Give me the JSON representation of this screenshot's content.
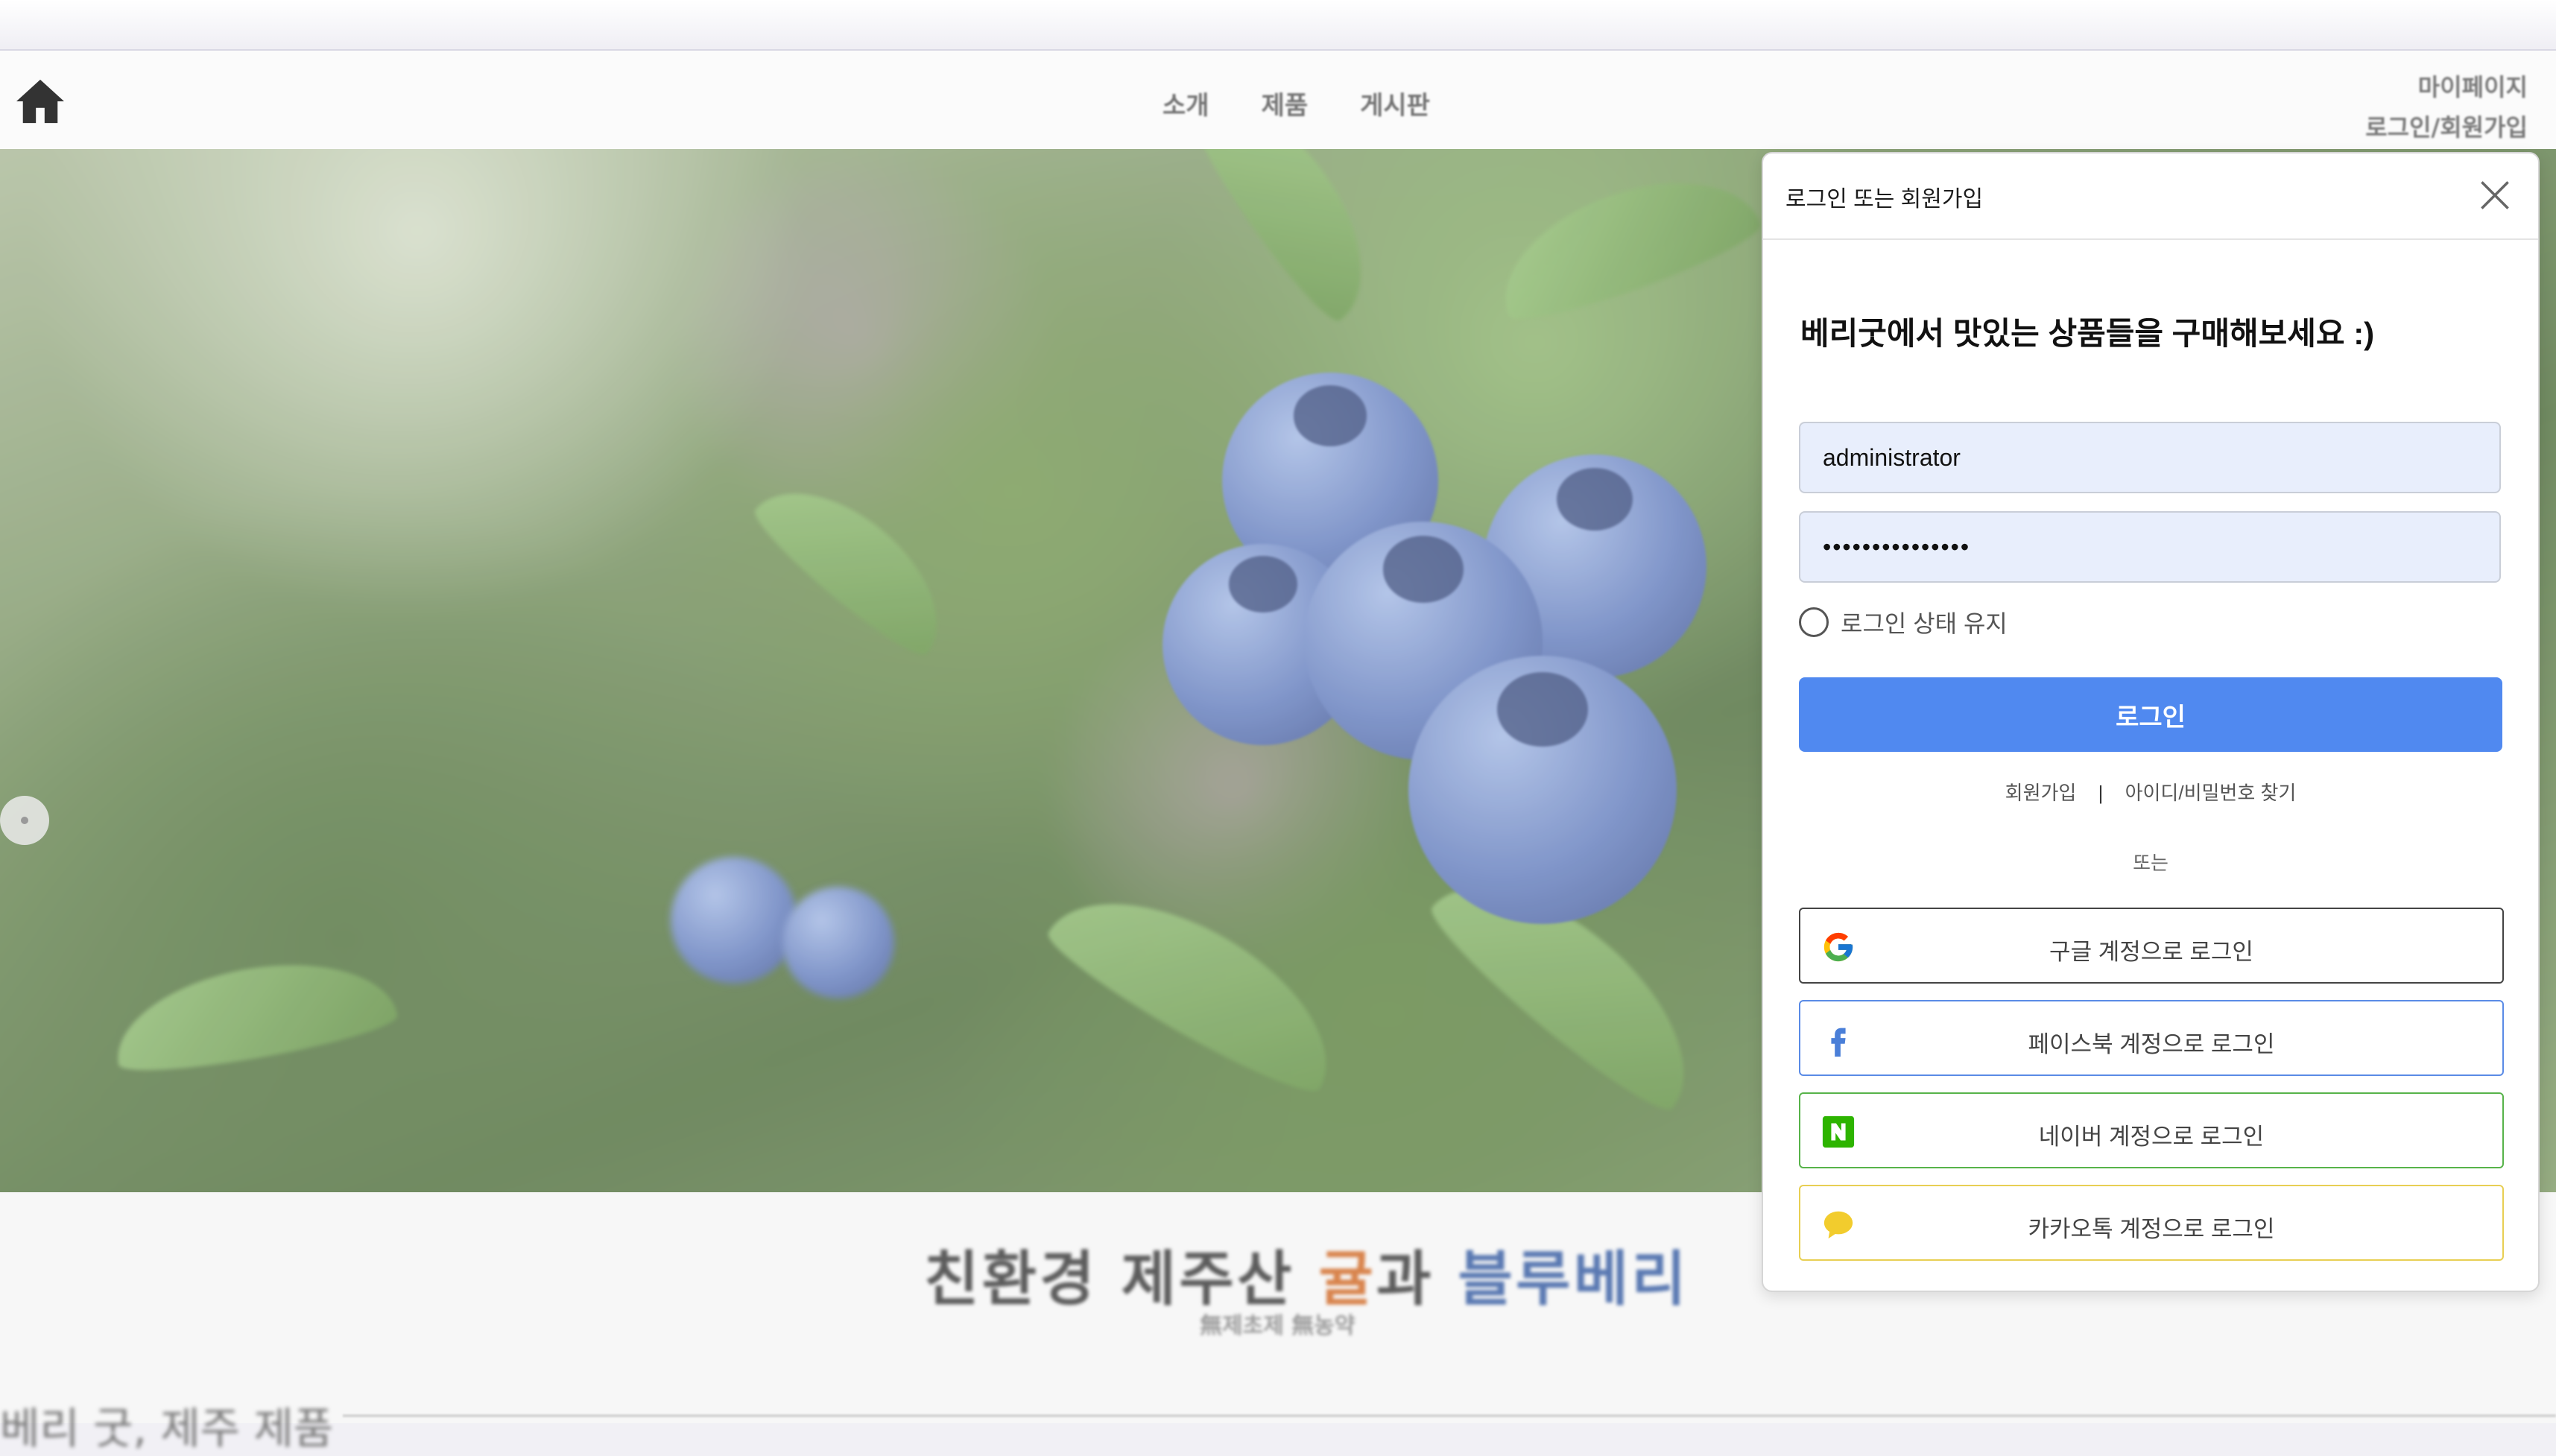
{
  "nav": {
    "links": [
      "소개",
      "제품",
      "게시판"
    ],
    "mypage": "마이페이지",
    "login_signup": "로그인/회원가입"
  },
  "hero": {
    "title_part1": "친환경 제주산 ",
    "title_orange": "귤",
    "title_mid": "과 ",
    "title_blue": "블루베리",
    "subtitle": "無제초제 無농약",
    "section_title": "베리 굿, 제주 제품",
    "slide_count": 2,
    "active_slide": 2
  },
  "modal": {
    "title": "로그인 또는 회원가입",
    "headline": "베리굿에서 맛있는 상품들을 구매해보세요 :)",
    "username_value": "administrator",
    "password_value": "•••••••••••••••",
    "remember_label": "로그인 상태 유지",
    "login_button": "로그인",
    "signup_link": "회원가입",
    "separator": "|",
    "find_link": "아이디/비밀번호 찾기",
    "or_text": "또는",
    "google_label": "구글 계정으로 로그인",
    "facebook_label": "페이스북 계정으로 로그인",
    "naver_label": "네이버 계정으로 로그인",
    "kakao_label": "카카오톡 계정으로 로그인"
  },
  "colors": {
    "login_button": "#5089f0",
    "input_bg": "#e8eefc",
    "google_border": "#444444",
    "facebook": "#5a8be6",
    "naver": "#57b34a",
    "kakao": "#e8cf53",
    "title_orange": "#d8844d",
    "title_blue": "#5a79b2"
  },
  "icons": {
    "home": "home-icon",
    "close": "close-icon",
    "google": "google-icon",
    "facebook": "facebook-icon",
    "naver": "naver-icon",
    "kakao": "kakao-icon"
  }
}
